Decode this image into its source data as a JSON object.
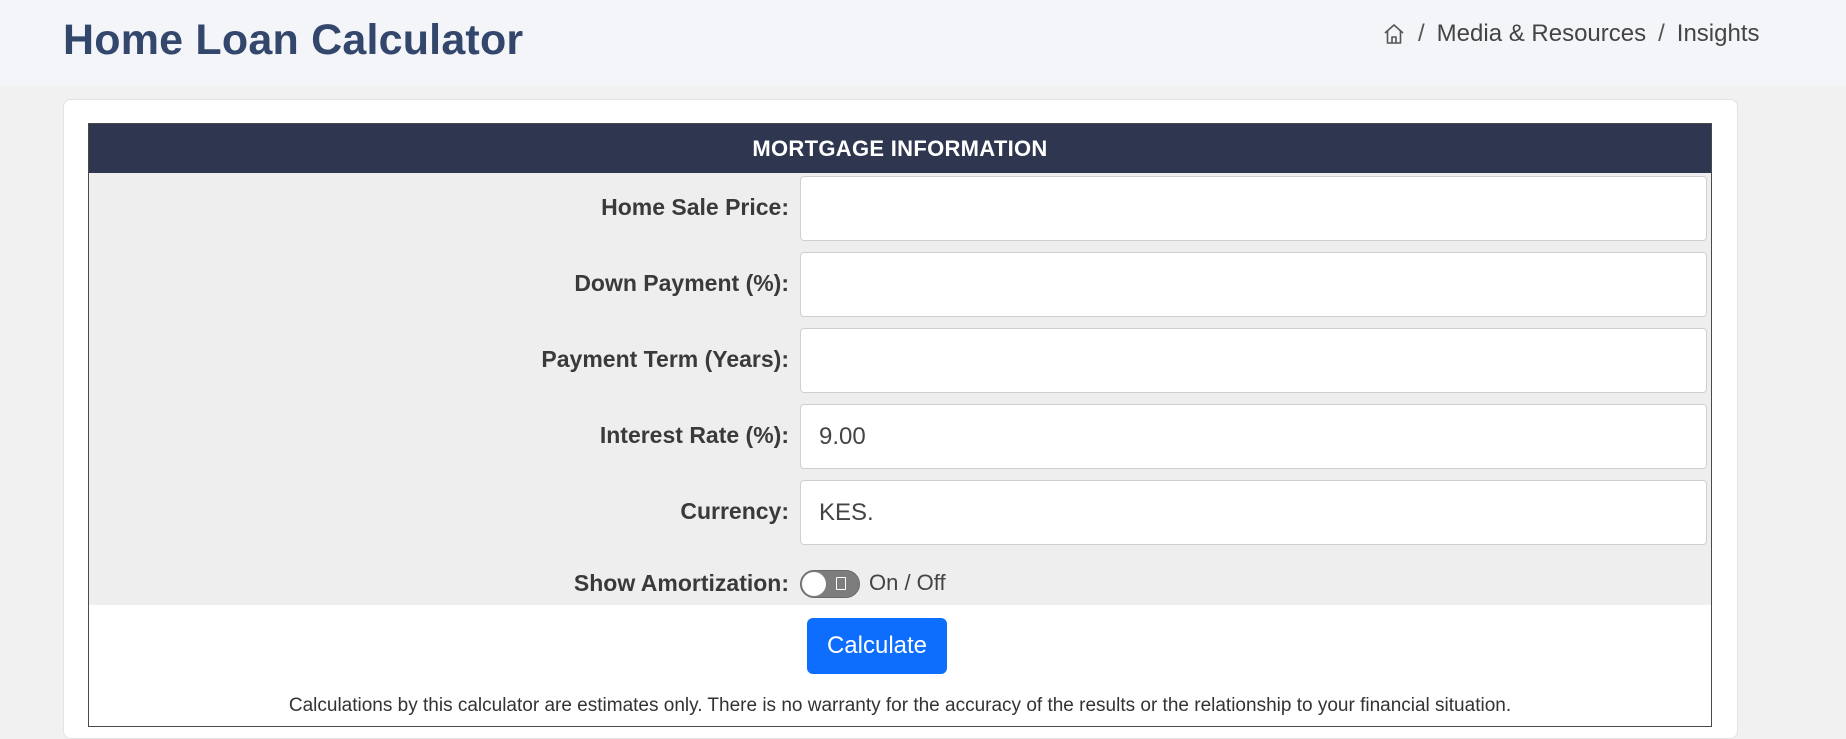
{
  "header": {
    "title": "Home Loan Calculator",
    "breadcrumb": {
      "home_icon": "home-icon",
      "separator": "/",
      "items": [
        "Media & Resources",
        "Insights"
      ]
    }
  },
  "calculator": {
    "section_title": "MORTGAGE INFORMATION",
    "fields": [
      {
        "label": "Home Sale Price:",
        "value": ""
      },
      {
        "label": "Down Payment (%):",
        "value": ""
      },
      {
        "label": "Payment Term (Years):",
        "value": ""
      },
      {
        "label": "Interest Rate (%):",
        "value": "9.00"
      },
      {
        "label": "Currency:",
        "value": "KES."
      }
    ],
    "amortization": {
      "label": "Show Amortization:",
      "toggle_text": "On / Off",
      "enabled": false
    },
    "calculate_label": "Calculate",
    "disclaimer": "Calculations by this calculator are estimates only. There is no warranty for the accuracy of the results or the relationship to your financial situation."
  },
  "colors": {
    "title": "#33466b",
    "section_header_bg": "#2f3650",
    "button_bg": "#0d6efd",
    "form_bg": "#eeeeee",
    "page_bg": "#f1f1f1"
  }
}
